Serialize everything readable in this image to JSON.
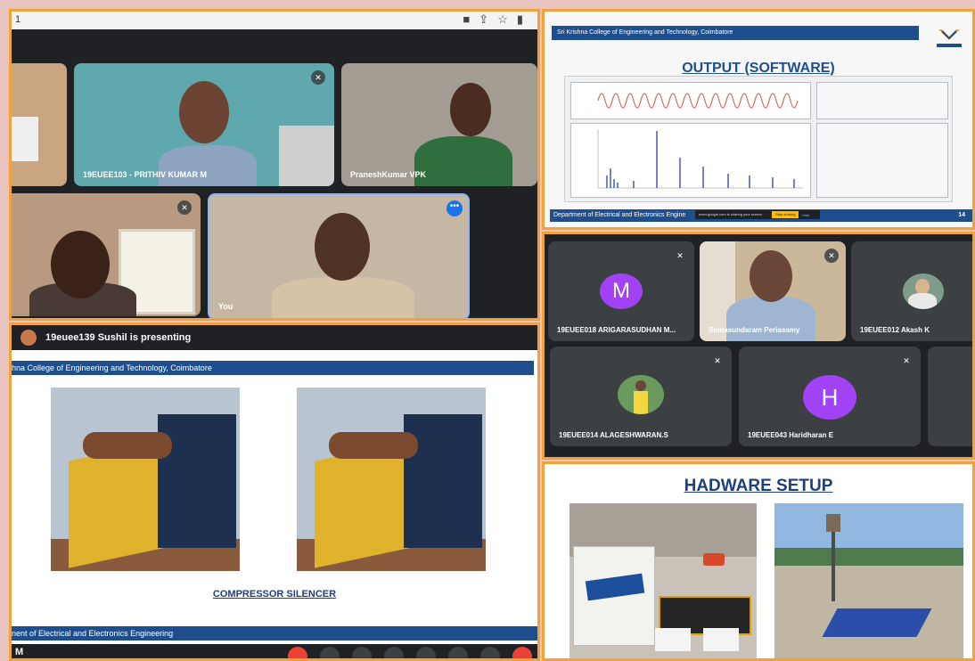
{
  "meet_grid_a": {
    "tab_number": "1",
    "participants": [
      {
        "name": "19EUEE103 - PRITHIV KUMAR M"
      },
      {
        "name": "PraneshKumar VPK"
      },
      {
        "name": "You"
      }
    ]
  },
  "slide_output": {
    "header": "Sri Krishna College of  Engineering and Technology, Coimbatore",
    "title": "OUTPUT (SOFTWARE)",
    "footer": "Department of Electrical and Electronics Engine",
    "page_number": "14",
    "share_toast": {
      "text": "meet.google.com is sharing your screen",
      "stop_label": "Stop sharing",
      "hide_label": "Hide"
    }
  },
  "meet_grid_c": {
    "participants": [
      {
        "name": "19EUEE018 ARIGARASUDHAN M...",
        "avatar_letter": "M",
        "avatar_color": "#a142f4"
      },
      {
        "name": "Somasundaram Periasamy"
      },
      {
        "name": "19EUEE012 Akash K"
      },
      {
        "name": "19EUEE014 ALAGESHWARAN.S"
      },
      {
        "name": "19EUEE043 Haridharan E",
        "avatar_letter": "H",
        "avatar_color": "#a142f4"
      }
    ]
  },
  "slide_compressor": {
    "presenting_text": "19euee139 Sushil is presenting",
    "header": "hna College of  Engineering and Technology, Coimbatore",
    "caption": "COMPRESSOR SILENCER",
    "footer": "nent of Electrical and Electronics Engineering",
    "controls_left_text": "M"
  },
  "slide_hardware": {
    "title": "HADWARE SETUP"
  },
  "colors": {
    "accent_orange": "#f0a33a",
    "meet_dark": "#202124",
    "slide_blue": "#1f4e8c"
  }
}
